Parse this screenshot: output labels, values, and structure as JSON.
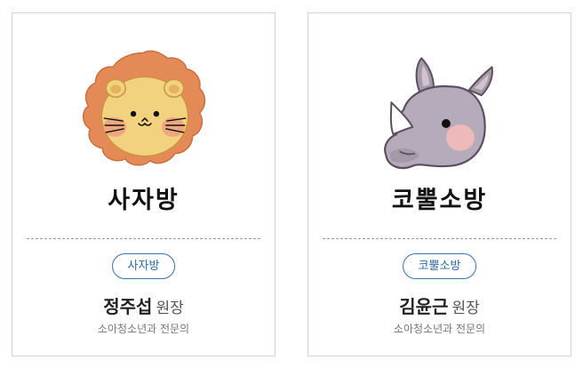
{
  "cards": [
    {
      "title": "사자방",
      "badge": "사자방",
      "doctor_name": "정주섭",
      "doctor_role": "원장",
      "specialty": "소아청소년과 전문의",
      "icon": "lion-icon"
    },
    {
      "title": "코뿔소방",
      "badge": "코뿔소방",
      "doctor_name": "김윤근",
      "doctor_role": "원장",
      "specialty": "소아청소년과 전문의",
      "icon": "rhino-icon"
    }
  ]
}
